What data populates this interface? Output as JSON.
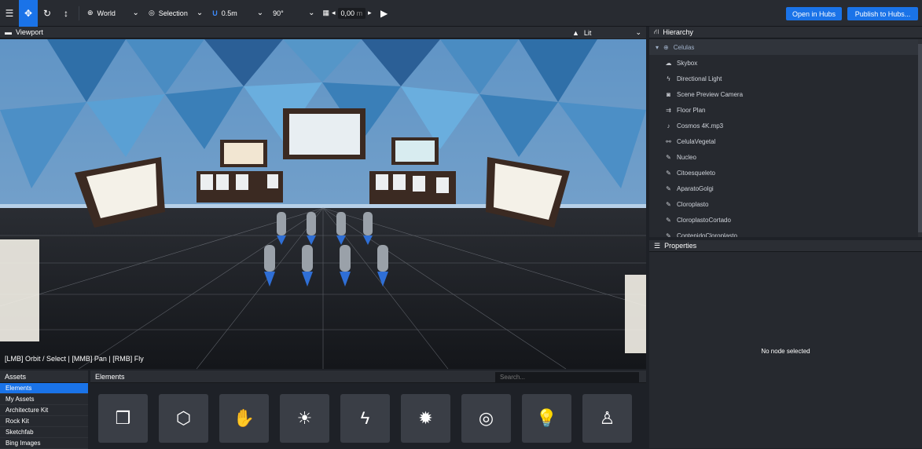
{
  "toolbar": {
    "menu_icon": "☰",
    "move_icon": "✥",
    "rotate_icon": "↻",
    "scale_icon": "↕",
    "space_value": "World",
    "pivot_value": "Selection",
    "snap_translate": "0.5m",
    "snap_rotate": "90°",
    "grid_height": "0,00",
    "grid_unit": "m",
    "open_hubs": "Open in Hubs",
    "publish_hubs": "Publish to Hubs..."
  },
  "viewport": {
    "title": "Viewport",
    "render_mode": "Lit",
    "controls_hint": "[LMB] Orbit / Select | [MMB] Pan | [RMB] Fly"
  },
  "hierarchy": {
    "title": "Hierarchy",
    "root": "Celulas",
    "items": [
      {
        "label": "Skybox",
        "icon": "☁"
      },
      {
        "label": "Directional Light",
        "icon": "ϟ"
      },
      {
        "label": "Scene Preview Camera",
        "icon": "◙"
      },
      {
        "label": "Floor Plan",
        "icon": "⇉"
      },
      {
        "label": "Cosmos 4K.mp3",
        "icon": "♪"
      },
      {
        "label": "CelulaVegetal",
        "icon": "⚯"
      },
      {
        "label": "Nucleo",
        "icon": "✎"
      },
      {
        "label": "Citoesqueleto",
        "icon": "✎"
      },
      {
        "label": "AparatoGolgi",
        "icon": "✎"
      },
      {
        "label": "Cloroplasto",
        "icon": "✎"
      },
      {
        "label": "CloroplastoCortado",
        "icon": "✎"
      },
      {
        "label": "ContenidoCloroplasto",
        "icon": "✎"
      }
    ]
  },
  "properties": {
    "title": "Properties",
    "empty_text": "No node selected"
  },
  "assets": {
    "title": "Assets",
    "items": [
      "Elements",
      "My Assets",
      "Architecture Kit",
      "Rock Kit",
      "Sketchfab",
      "Bing Images"
    ],
    "selected": "Elements"
  },
  "elements": {
    "title": "Elements",
    "search_placeholder": "Search...",
    "tiles": [
      {
        "glyph": "❒",
        "name": "boxes-icon"
      },
      {
        "glyph": "⬡",
        "name": "cube-icon"
      },
      {
        "glyph": "✋",
        "name": "hand-icon"
      },
      {
        "glyph": "☀",
        "name": "sun-icon"
      },
      {
        "glyph": "ϟ",
        "name": "bolt-icon"
      },
      {
        "glyph": "✹",
        "name": "burst-icon"
      },
      {
        "glyph": "◎",
        "name": "target-icon"
      },
      {
        "glyph": "💡",
        "name": "bulb-icon"
      },
      {
        "glyph": "♙",
        "name": "spawn-icon"
      }
    ]
  },
  "colors": {
    "accent": "#1a73e8",
    "panel": "#26292f",
    "toolbar": "#282b31"
  }
}
